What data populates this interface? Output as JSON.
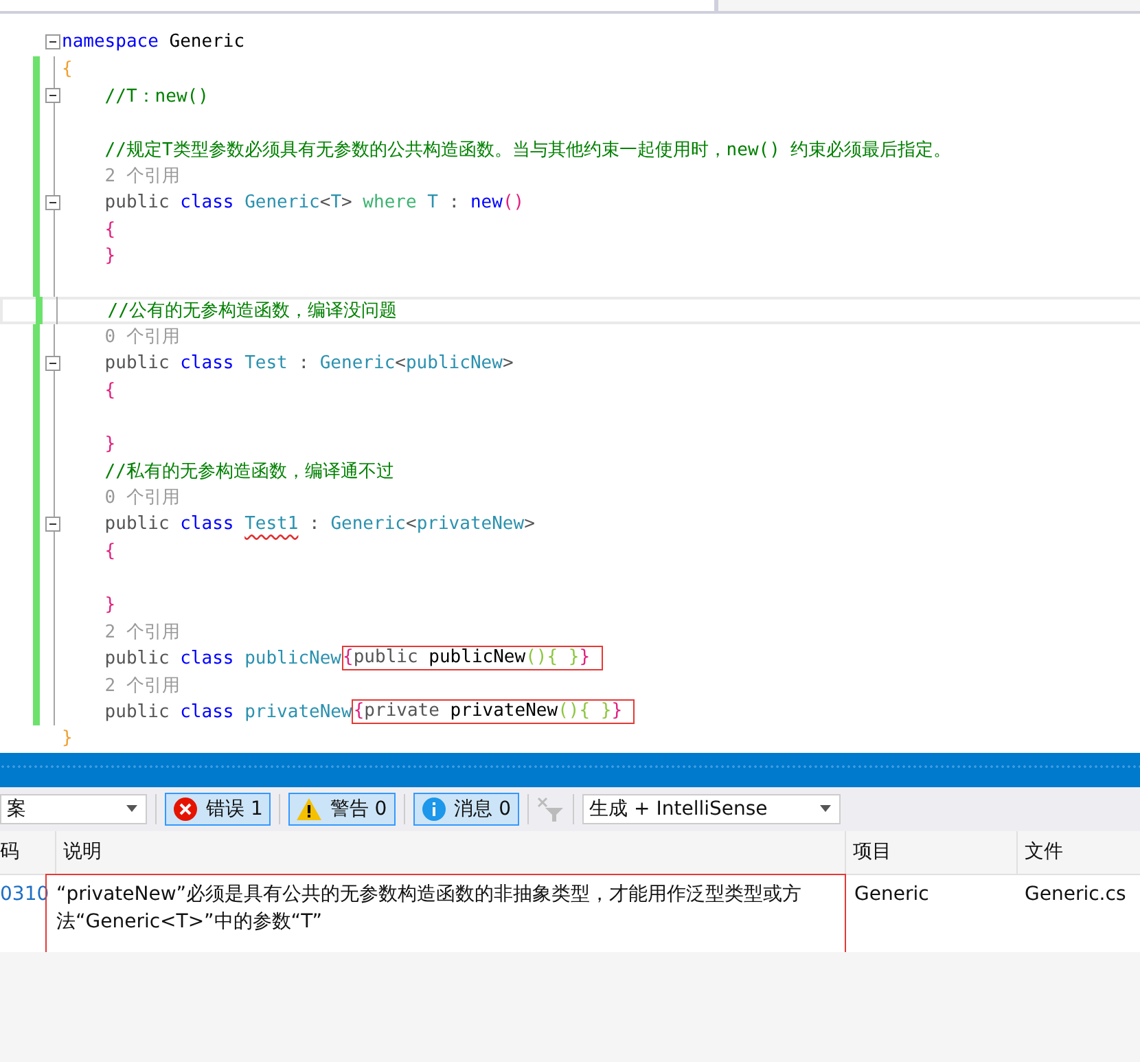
{
  "editor": {
    "lines": [
      {
        "fold": true,
        "changed": false,
        "current": false,
        "tokens": [
          {
            "text": "namespace ",
            "kind": "keyword"
          },
          {
            "text": "Generic",
            "kind": "ident"
          }
        ]
      },
      {
        "fold": false,
        "changed": true,
        "current": false,
        "tokens": [
          {
            "text": "{",
            "kind": "outer-brace"
          }
        ]
      },
      {
        "fold": true,
        "changed": true,
        "current": false,
        "tokens": [
          {
            "text": "    //T：new()",
            "kind": "comment"
          }
        ]
      },
      {
        "fold": false,
        "changed": true,
        "current": false
      },
      {
        "fold": false,
        "changed": true,
        "current": false,
        "tokens": [
          {
            "text": "    //规定T类型参数必须具有无参数的公共构造函数。当与其他约束一起使用时，new() 约束必须最后指定。",
            "kind": "comment"
          }
        ]
      },
      {
        "fold": false,
        "changed": true,
        "current": false,
        "tokens": [
          {
            "text": "    2 个引用",
            "kind": "reference"
          }
        ]
      },
      {
        "fold": true,
        "changed": true,
        "current": false,
        "tokens": [
          {
            "text": "    public ",
            "kind": "plain"
          },
          {
            "text": "class ",
            "kind": "keyword"
          },
          {
            "text": "Generic",
            "kind": "type"
          },
          {
            "text": "<",
            "kind": "plain"
          },
          {
            "text": "T",
            "kind": "type"
          },
          {
            "text": "> ",
            "kind": "plain"
          },
          {
            "text": "where ",
            "kind": "context"
          },
          {
            "text": "T",
            "kind": "type"
          },
          {
            "text": " : ",
            "kind": "plain"
          },
          {
            "text": "new",
            "kind": "keyword"
          },
          {
            "text": "()",
            "kind": "brace"
          }
        ]
      },
      {
        "fold": false,
        "changed": true,
        "current": false,
        "tokens": [
          {
            "text": "    {",
            "kind": "brace"
          }
        ]
      },
      {
        "fold": false,
        "changed": true,
        "current": false,
        "tokens": [
          {
            "text": "    }",
            "kind": "brace"
          }
        ]
      },
      {
        "fold": false,
        "changed": true,
        "current": false
      },
      {
        "fold": false,
        "changed": true,
        "current": true,
        "tokens": [
          {
            "text": "    //公有的无参构造函数，编译没问题",
            "kind": "comment"
          }
        ]
      },
      {
        "fold": false,
        "changed": true,
        "current": false,
        "tokens": [
          {
            "text": "    0 个引用",
            "kind": "reference"
          }
        ]
      },
      {
        "fold": true,
        "changed": true,
        "current": false,
        "tokens": [
          {
            "text": "    public ",
            "kind": "plain"
          },
          {
            "text": "class ",
            "kind": "keyword"
          },
          {
            "text": "Test",
            "kind": "type"
          },
          {
            "text": " : ",
            "kind": "plain"
          },
          {
            "text": "Generic",
            "kind": "type"
          },
          {
            "text": "<",
            "kind": "plain"
          },
          {
            "text": "publicNew",
            "kind": "type"
          },
          {
            "text": ">",
            "kind": "plain"
          }
        ]
      },
      {
        "fold": false,
        "changed": true,
        "current": false,
        "tokens": [
          {
            "text": "    {",
            "kind": "brace"
          }
        ]
      },
      {
        "fold": false,
        "changed": true,
        "current": false
      },
      {
        "fold": false,
        "changed": true,
        "current": false,
        "tokens": [
          {
            "text": "    }",
            "kind": "brace"
          }
        ]
      },
      {
        "fold": false,
        "changed": true,
        "current": false,
        "tokens": [
          {
            "text": "    //私有的无参构造函数，编译通不过",
            "kind": "comment"
          }
        ]
      },
      {
        "fold": false,
        "changed": true,
        "current": false,
        "tokens": [
          {
            "text": "    0 个引用",
            "kind": "reference"
          }
        ]
      },
      {
        "fold": true,
        "changed": true,
        "current": false,
        "tokens": [
          {
            "text": "    public ",
            "kind": "plain"
          },
          {
            "text": "class ",
            "kind": "keyword"
          },
          {
            "text": "Test1",
            "kind": "error"
          },
          {
            "text": " : ",
            "kind": "plain"
          },
          {
            "text": "Generic",
            "kind": "type"
          },
          {
            "text": "<",
            "kind": "plain"
          },
          {
            "text": "privateNew",
            "kind": "type"
          },
          {
            "text": ">",
            "kind": "plain"
          }
        ]
      },
      {
        "fold": false,
        "changed": true,
        "current": false,
        "tokens": [
          {
            "text": "    {",
            "kind": "brace"
          }
        ]
      },
      {
        "fold": false,
        "changed": true,
        "current": false
      },
      {
        "fold": false,
        "changed": true,
        "current": false,
        "tokens": [
          {
            "text": "    }",
            "kind": "brace"
          }
        ]
      },
      {
        "fold": false,
        "changed": true,
        "current": false,
        "tokens": [
          {
            "text": "    2 个引用",
            "kind": "reference"
          }
        ]
      },
      {
        "fold": false,
        "changed": true,
        "current": false,
        "tokens": [
          {
            "text": "    public ",
            "kind": "plain"
          },
          {
            "text": "class ",
            "kind": "keyword"
          },
          {
            "text": "publicNew",
            "kind": "type"
          },
          {
            "kind": "box",
            "tokens": [
              {
                "text": "{",
                "kind": "brace"
              },
              {
                "text": "public ",
                "kind": "plain"
              },
              {
                "text": "publicNew",
                "kind": "ident"
              },
              {
                "text": "()",
                "kind": "paren"
              },
              {
                "text": "{ }",
                "kind": "paren"
              },
              {
                "text": "}",
                "kind": "brace"
              }
            ]
          }
        ]
      },
      {
        "fold": false,
        "changed": true,
        "current": false,
        "tokens": [
          {
            "text": "    2 个引用",
            "kind": "reference"
          }
        ]
      },
      {
        "fold": false,
        "changed": true,
        "current": false,
        "tokens": [
          {
            "text": "    public ",
            "kind": "plain"
          },
          {
            "text": "class ",
            "kind": "keyword"
          },
          {
            "text": "privateNew",
            "kind": "type"
          },
          {
            "kind": "box",
            "tokens": [
              {
                "text": "{",
                "kind": "brace"
              },
              {
                "text": "private ",
                "kind": "plain"
              },
              {
                "text": "privateNew",
                "kind": "ident"
              },
              {
                "text": "()",
                "kind": "paren"
              },
              {
                "text": "{ ",
                "kind": "paren"
              },
              {
                "text": "}",
                "kind": "paren"
              },
              {
                "text": "}",
                "kind": "brace"
              }
            ]
          }
        ]
      },
      {
        "fold": false,
        "changed": false,
        "current": false,
        "tokens": [
          {
            "text": "}",
            "kind": "outer-brace"
          }
        ]
      }
    ]
  },
  "error_list": {
    "scope_dropdown": "案",
    "filters": [
      {
        "kind": "error",
        "label": "错误 1",
        "selected": true
      },
      {
        "kind": "warning",
        "label": "警告 0",
        "selected": true
      },
      {
        "kind": "info",
        "label": "消息 0",
        "selected": true
      }
    ],
    "source_dropdown": "生成 + IntelliSense",
    "columns": [
      "码",
      "说明",
      "项目",
      "文件"
    ],
    "rows": [
      {
        "code": "0310",
        "description": "“privateNew”必须是具有公共的无参数构造函数的非抽象类型，才能用作泛型类型或方法“Generic<T>”中的参数“T”",
        "project": "Generic",
        "file": "Generic.cs",
        "boxed": true
      }
    ]
  }
}
